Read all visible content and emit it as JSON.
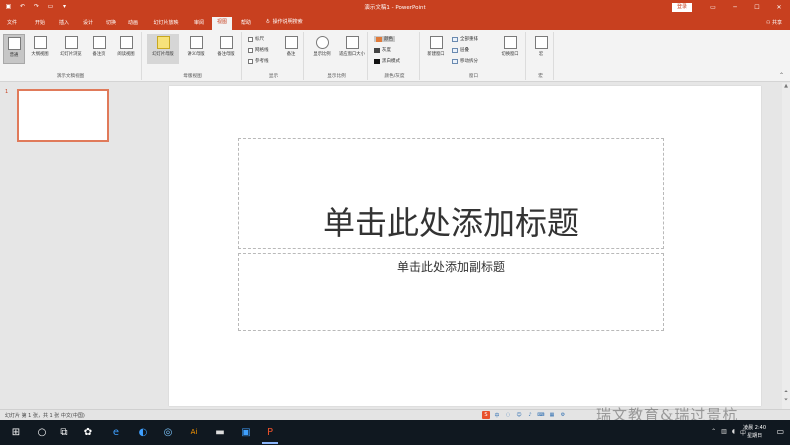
{
  "window": {
    "title": "演示文稿1 - PowerPoint",
    "login_label": "登录"
  },
  "tabs": [
    {
      "label": "文件"
    },
    {
      "label": "开始"
    },
    {
      "label": "插入"
    },
    {
      "label": "设计"
    },
    {
      "label": "切换"
    },
    {
      "label": "动画"
    },
    {
      "label": "幻灯片放映"
    },
    {
      "label": "审阅"
    },
    {
      "label": "视图",
      "active": true
    },
    {
      "label": "帮助"
    }
  ],
  "tell_me": "操作说明搜索",
  "share_label": "共享",
  "ribbon": {
    "presentation_views": {
      "label": "演示文稿视图",
      "buttons": [
        "普通",
        "大纲视图",
        "幻灯片浏览",
        "备注页",
        "阅读视图"
      ]
    },
    "master_views": {
      "label": "母版视图",
      "buttons": [
        "幻灯片母版",
        "讲义母版",
        "备注母版"
      ]
    },
    "show": {
      "label": "显示",
      "checkboxes": [
        "标尺",
        "网格线",
        "参考线"
      ],
      "notes_button": "备注"
    },
    "zoom": {
      "label": "显示比例",
      "buttons": [
        "显示比例",
        "适应窗口大小"
      ]
    },
    "color": {
      "label": "颜色/灰度",
      "options": [
        "颜色",
        "灰度",
        "黑白模式"
      ]
    },
    "window_group": {
      "label": "窗口",
      "new_window": "新建窗口",
      "small": [
        "全部重排",
        "层叠",
        "移动拆分"
      ],
      "switch": "切换窗口"
    },
    "macros": {
      "label": "宏",
      "button": "宏"
    }
  },
  "thumbnail_number": "1",
  "slide": {
    "title_placeholder": "单击此处添加标题",
    "subtitle_placeholder": "单击此处添加副标题"
  },
  "status": {
    "text": "幻灯片 第 1 张，共 1 张    中文(中国)"
  },
  "watermark": "瑞文教育&瑞过景杭",
  "clock": {
    "time": "2:40",
    "day": "星期日",
    "prefix": "凌晨"
  }
}
